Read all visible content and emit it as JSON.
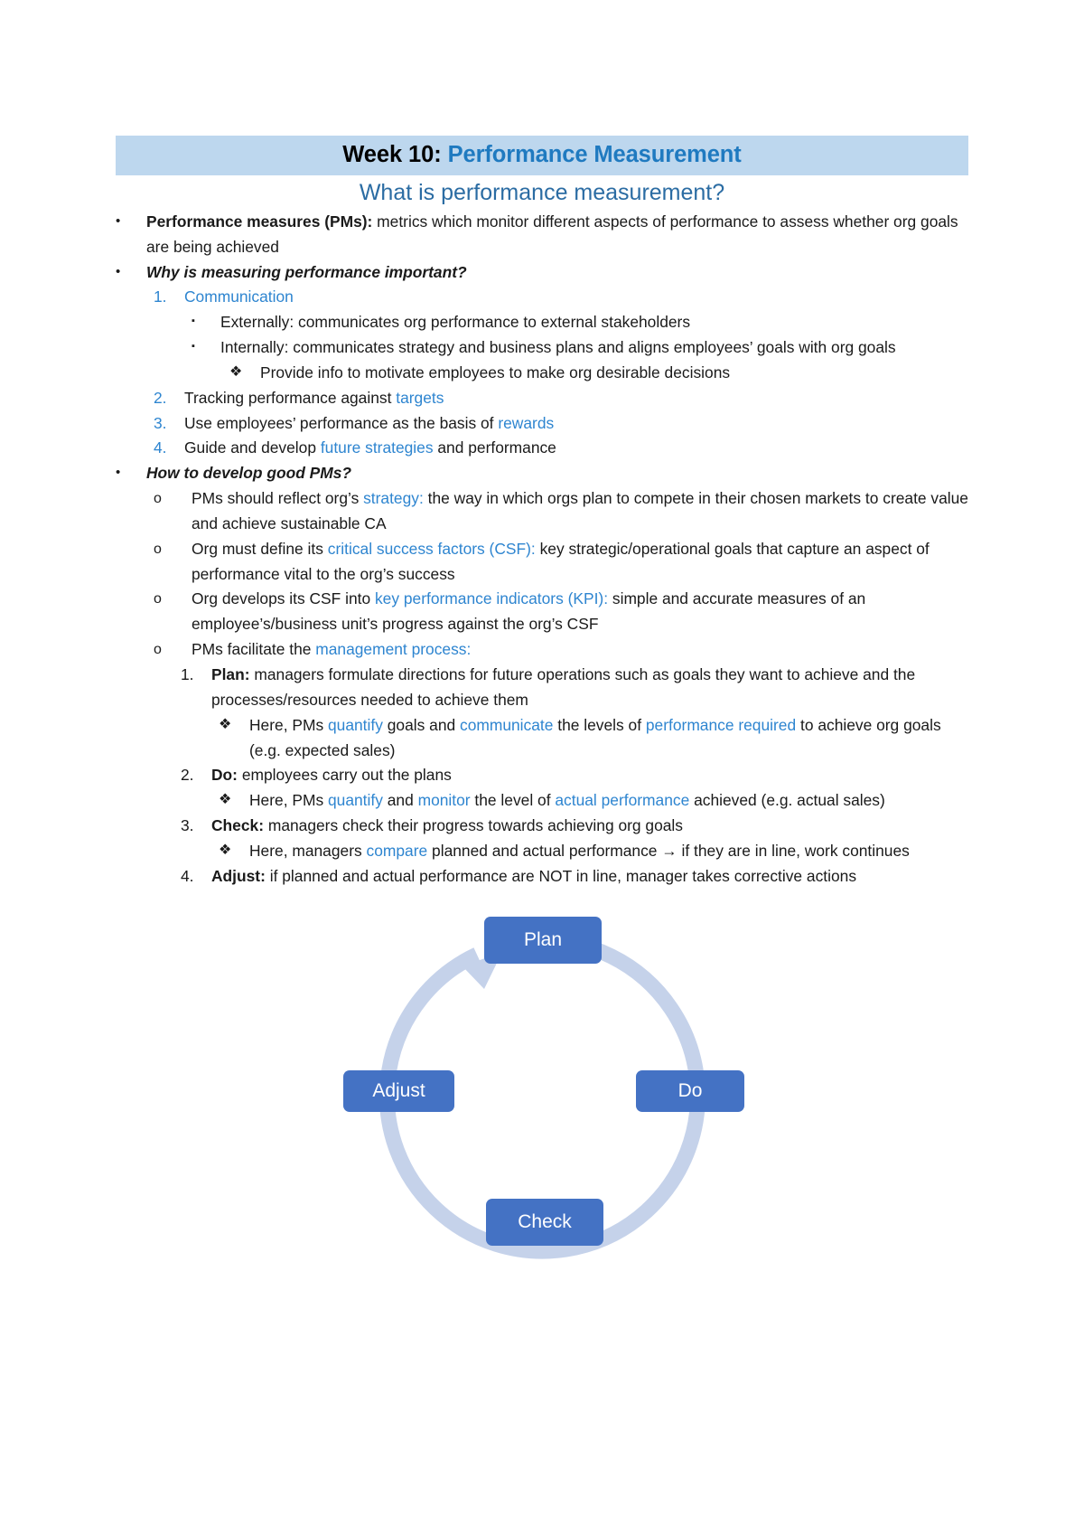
{
  "header": {
    "week_label": "Week 10:",
    "topic": "Performance Measurement",
    "subtitle": "What is performance measurement?",
    "band_color": "#bdd7ee",
    "topic_color": "#1f7ac0",
    "subtitle_color": "#2b6ca3"
  },
  "markers": {
    "bullet": "•",
    "square": "▪",
    "diamond": "❖",
    "circle": "o",
    "n1": "1.",
    "n2": "2.",
    "n3": "3.",
    "n4": "4."
  },
  "content": {
    "pm_def_label": "Performance measures (PMs):",
    "pm_def_text": " metrics which monitor different aspects of performance to assess whether org goals are being achieved",
    "why_heading": "Why is measuring performance important?",
    "why_1_label": "Communication",
    "why_1_sub_a": "Externally: communicates org performance to external stakeholders",
    "why_1_sub_b": "Internally: communicates strategy and business plans and aligns employees’ goals with org goals",
    "why_1_sub_b_diamond": "Provide info to motivate employees to make org desirable decisions",
    "why_2_pre": "Tracking performance against ",
    "why_2_blue": "targets",
    "why_3_pre": "Use employees’ performance as the basis of ",
    "why_3_blue": "rewards",
    "why_4_pre": "Guide and develop ",
    "why_4_blue": "future strategies",
    "why_4_post": " and performance",
    "how_heading": "How to develop good PMs?",
    "how_1_pre": "PMs should reflect org’s ",
    "how_1_blue": "strategy:",
    "how_1_post": " the way in which orgs plan to compete in their chosen markets to create value and achieve sustainable CA",
    "how_2_pre": "Org must define its ",
    "how_2_blue": "critical success factors (CSF):",
    "how_2_post": " key strategic/operational goals that capture an aspect of performance vital to the org’s success",
    "how_3_pre": "Org develops its CSF into ",
    "how_3_blue": "key performance indicators (KPI):",
    "how_3_post": " simple and accurate measures of an employee’s/business unit’s progress against the org’s CSF",
    "how_4_pre": "PMs facilitate the ",
    "how_4_blue": "management process:",
    "plan_label": "Plan:",
    "plan_text": " managers formulate directions for future operations such as goals they want to achieve and the processes/resources needed to achieve them",
    "plan_sub_1": "Here, PMs ",
    "plan_sub_blue1": "quantify",
    "plan_sub_2": " goals and ",
    "plan_sub_blue2": "communicate",
    "plan_sub_3": " the levels of ",
    "plan_sub_blue3": "performance required",
    "plan_sub_4": " to achieve org goals (e.g. expected sales)",
    "do_label": "Do:",
    "do_text": " employees carry out the plans",
    "do_sub_1": "Here, PMs ",
    "do_sub_blue1": "quantify",
    "do_sub_2": " and ",
    "do_sub_blue2": "monitor",
    "do_sub_3": " the level of ",
    "do_sub_blue3": "actual performance",
    "do_sub_4": " achieved (e.g. actual sales)",
    "check_label": "Check:",
    "check_text": " managers check their progress towards achieving org goals",
    "check_sub_1": "Here, managers ",
    "check_sub_blue1": "compare",
    "check_sub_2": " planned and actual performance → if they are in line, work continues",
    "adjust_label": "Adjust:",
    "adjust_text": " if planned and actual performance are NOT in line, manager takes corrective actions"
  },
  "diagram": {
    "type": "cycle",
    "node_color": "#4472c4",
    "ring_color": "#c5d2ea",
    "nodes": [
      {
        "id": "plan",
        "label": "Plan"
      },
      {
        "id": "do",
        "label": "Do"
      },
      {
        "id": "check",
        "label": "Check"
      },
      {
        "id": "adjust",
        "label": "Adjust"
      }
    ]
  }
}
